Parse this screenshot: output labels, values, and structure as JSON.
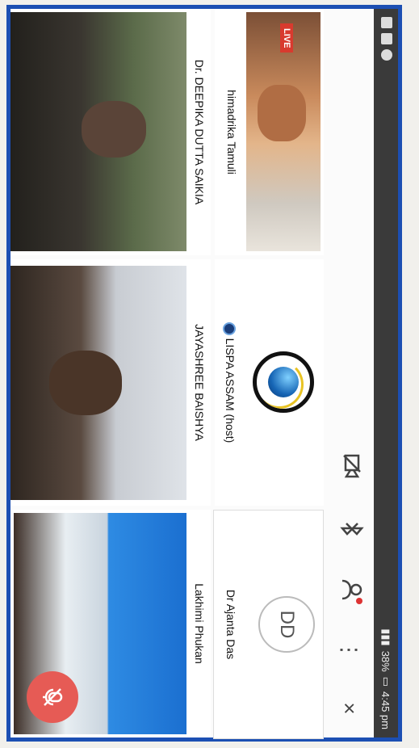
{
  "statusbar": {
    "right_text": "38% ",
    "time": "4:45 pm"
  },
  "toolbar": {
    "close_icon": "×",
    "more_icon": "⋮",
    "participants_icon": "participants-icon",
    "bluetooth_icon": "bluetooth-icon",
    "video_off_icon": "video-off-icon"
  },
  "participants": [
    {
      "name": "Dr Ajanta Das",
      "initials": "DD"
    },
    {
      "name": "LISPA ASSAM (host)"
    },
    {
      "name": "himadrika Tamuli",
      "badge": "LIVE"
    },
    {
      "name": "Lakhimi Phukan"
    },
    {
      "name": "JAYASHREE BAISHYA"
    },
    {
      "name": "Dr. DEEPIKA DUTTA SAIKIA"
    }
  ],
  "colors": {
    "fab": "#e65b55",
    "frame": "#1c4fb3"
  }
}
